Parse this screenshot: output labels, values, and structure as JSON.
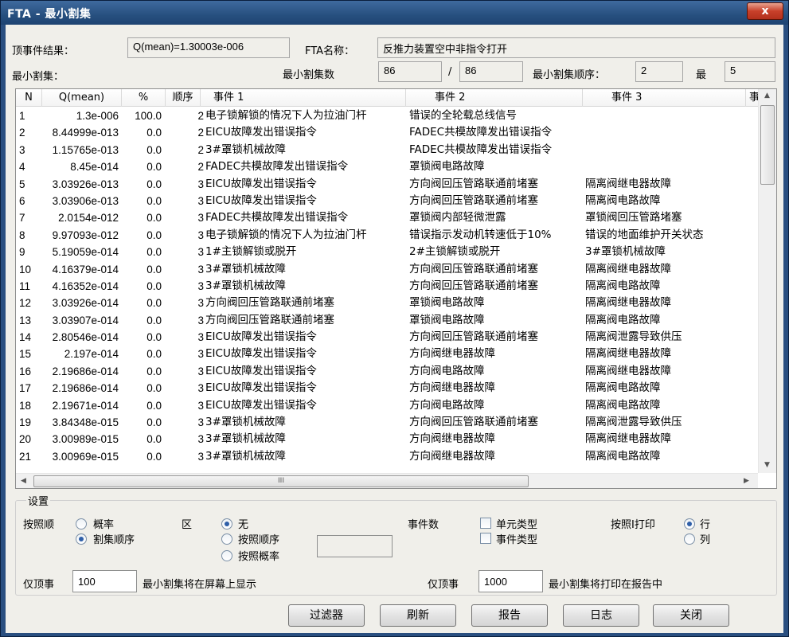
{
  "window": {
    "title": "FTA - 最小割集",
    "close_glyph": "x"
  },
  "top": {
    "top_event_label": "顶事件结果：",
    "top_event_value": "Q(mean)=1.30003e-006",
    "fta_name_label": "FTA名称：",
    "fta_name_value": "反推力装置空中非指令打开",
    "mincut_label": "最小割集：",
    "mincut_count_label": "最小割集数",
    "mincut_count": "86",
    "slash": "/",
    "mincut_total": "86",
    "order_label": "最小割集顺序：",
    "order_min": "2",
    "max_label": "最",
    "order_max": "5"
  },
  "table": {
    "headers": [
      "N",
      "Q(mean)",
      "%",
      "顺序",
      "事件 1",
      "事件 2",
      "事件 3",
      "事"
    ],
    "rows": [
      [
        "1",
        "1.3e-006",
        "100.0",
        "2",
        "电子锁解锁的情况下人为拉油门杆",
        "错误的全轮载总线信号",
        ""
      ],
      [
        "2",
        "8.44999e-013",
        "0.0",
        "2",
        "EICU故障发出错误指令",
        "FADEC共模故障发出错误指令",
        ""
      ],
      [
        "3",
        "1.15765e-013",
        "0.0",
        "2",
        "3#罩锁机械故障",
        "FADEC共模故障发出错误指令",
        ""
      ],
      [
        "4",
        "8.45e-014",
        "0.0",
        "2",
        "FADEC共模故障发出错误指令",
        "罩锁阀电路故障",
        ""
      ],
      [
        "5",
        "3.03926e-013",
        "0.0",
        "3",
        "EICU故障发出错误指令",
        "方向阀回压管路联通前堵塞",
        "隔离阀继电器故障"
      ],
      [
        "6",
        "3.03906e-013",
        "0.0",
        "3",
        "EICU故障发出错误指令",
        "方向阀回压管路联通前堵塞",
        "隔离阀电路故障"
      ],
      [
        "7",
        "2.0154e-012",
        "0.0",
        "3",
        "FADEC共模故障发出错误指令",
        "罩锁阀内部轻微泄露",
        "罩锁阀回压管路堵塞"
      ],
      [
        "8",
        "9.97093e-012",
        "0.0",
        "3",
        "电子锁解锁的情况下人为拉油门杆",
        "错误指示发动机转速低于10%",
        "错误的地面维护开关状态"
      ],
      [
        "9",
        "5.19059e-014",
        "0.0",
        "3",
        "1#主锁解锁或脱开",
        "2#主锁解锁或脱开",
        "3#罩锁机械故障"
      ],
      [
        "10",
        "4.16379e-014",
        "0.0",
        "3",
        "3#罩锁机械故障",
        "方向阀回压管路联通前堵塞",
        "隔离阀继电器故障"
      ],
      [
        "11",
        "4.16352e-014",
        "0.0",
        "3",
        "3#罩锁机械故障",
        "方向阀回压管路联通前堵塞",
        "隔离阀电路故障"
      ],
      [
        "12",
        "3.03926e-014",
        "0.0",
        "3",
        "方向阀回压管路联通前堵塞",
        "罩锁阀电路故障",
        "隔离阀继电器故障"
      ],
      [
        "13",
        "3.03907e-014",
        "0.0",
        "3",
        "方向阀回压管路联通前堵塞",
        "罩锁阀电路故障",
        "隔离阀电路故障"
      ],
      [
        "14",
        "2.80546e-014",
        "0.0",
        "3",
        "EICU故障发出错误指令",
        "方向阀回压管路联通前堵塞",
        "隔离阀泄露导致供压"
      ],
      [
        "15",
        "2.197e-014",
        "0.0",
        "3",
        "EICU故障发出错误指令",
        "方向阀继电器故障",
        "隔离阀继电器故障"
      ],
      [
        "16",
        "2.19686e-014",
        "0.0",
        "3",
        "EICU故障发出错误指令",
        "方向阀电路故障",
        "隔离阀继电器故障"
      ],
      [
        "17",
        "2.19686e-014",
        "0.0",
        "3",
        "EICU故障发出错误指令",
        "方向阀继电器故障",
        "隔离阀电路故障"
      ],
      [
        "18",
        "2.19671e-014",
        "0.0",
        "3",
        "EICU故障发出错误指令",
        "方向阀电路故障",
        "隔离阀电路故障"
      ],
      [
        "19",
        "3.84348e-015",
        "0.0",
        "3",
        "3#罩锁机械故障",
        "方向阀回压管路联通前堵塞",
        "隔离阀泄露导致供压"
      ],
      [
        "20",
        "3.00989e-015",
        "0.0",
        "3",
        "3#罩锁机械故障",
        "方向阀继电器故障",
        "隔离阀继电器故障"
      ],
      [
        "21",
        "3.00969e-015",
        "0.0",
        "3",
        "3#罩锁机械故障",
        "方向阀继电器故障",
        "隔离阀电路故障"
      ]
    ],
    "hscroll_thumb_glyph": "III"
  },
  "settings": {
    "group_title": "设置",
    "sort_label": "按照顺",
    "sort_options": [
      "概率",
      "割集顺序"
    ],
    "sort_selected": 1,
    "zone_label": "区",
    "zone_options": [
      "无",
      "按照顺序",
      "按照概率"
    ],
    "zone_selected": 0,
    "event_count_label": "事件数",
    "event_checks": [
      "单元类型",
      "事件类型"
    ],
    "print_label": "按照I打印",
    "print_options": [
      "行",
      "列"
    ],
    "print_selected": 0,
    "screen_top_label": "仅顶事",
    "screen_top_value": "100",
    "screen_top_suffix": "最小割集将在屏幕上显示",
    "report_top_label": "仅顶事",
    "report_top_value": "1000",
    "report_top_suffix": "最小割集将打印在报告中"
  },
  "buttons": {
    "filter": "过滤器",
    "refresh": "刷新",
    "report": "报告",
    "log": "日志",
    "close": "关闭"
  }
}
